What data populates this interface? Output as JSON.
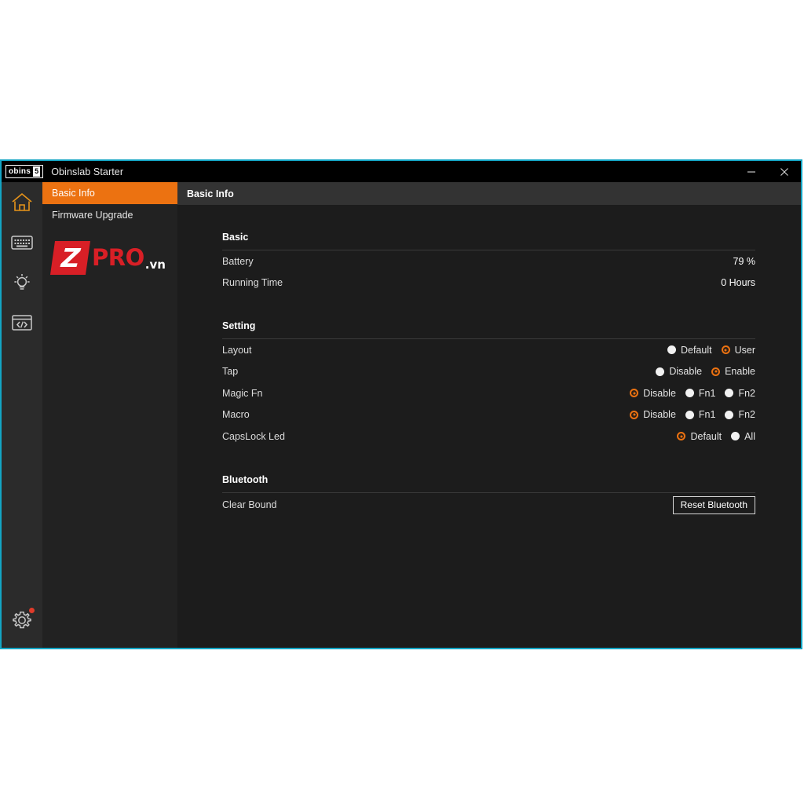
{
  "window": {
    "title": "Obinslab Starter",
    "brand_badge_text": "obins",
    "brand_badge_mark": "5",
    "minimize_label": "Minimize",
    "close_label": "Close",
    "border_color": "#13a5c4"
  },
  "icon_rail": {
    "items": [
      {
        "name": "home-icon",
        "label": "Home",
        "active": true
      },
      {
        "name": "keyboard-icon",
        "label": "Keyboard",
        "active": false
      },
      {
        "name": "lightbulb-icon",
        "label": "Lighting",
        "active": false
      },
      {
        "name": "code-icon",
        "label": "Macro Code",
        "active": false
      }
    ],
    "settings": {
      "name": "gear-icon",
      "label": "Settings",
      "badge": true,
      "badge_color": "#e03b2a"
    }
  },
  "sidebar": {
    "items": [
      {
        "label": "Basic Info",
        "selected": true
      },
      {
        "label": "Firmware Upgrade",
        "selected": false
      }
    ],
    "logo": {
      "z": "Z",
      "pro": "PRO",
      "vn": ".vn",
      "red": "#d81f26"
    }
  },
  "content": {
    "header": "Basic Info",
    "accent": "#ec7211",
    "sections": [
      {
        "title": "Basic",
        "rows": [
          {
            "label": "Battery",
            "value": "79 %"
          },
          {
            "label": "Running Time",
            "value": "0 Hours"
          }
        ]
      },
      {
        "title": "Setting",
        "rows": [
          {
            "label": "Layout",
            "options": [
              {
                "label": "Default",
                "selected": false
              },
              {
                "label": "User",
                "selected": true
              }
            ]
          },
          {
            "label": "Tap",
            "options": [
              {
                "label": "Disable",
                "selected": false
              },
              {
                "label": "Enable",
                "selected": true
              }
            ]
          },
          {
            "label": "Magic Fn",
            "options": [
              {
                "label": "Disable",
                "selected": true
              },
              {
                "label": "Fn1",
                "selected": false
              },
              {
                "label": "Fn2",
                "selected": false
              }
            ]
          },
          {
            "label": "Macro",
            "options": [
              {
                "label": "Disable",
                "selected": true
              },
              {
                "label": "Fn1",
                "selected": false
              },
              {
                "label": "Fn2",
                "selected": false
              }
            ]
          },
          {
            "label": "CapsLock Led",
            "options": [
              {
                "label": "Default",
                "selected": true
              },
              {
                "label": "All",
                "selected": false
              }
            ]
          }
        ]
      },
      {
        "title": "Bluetooth",
        "rows": [
          {
            "label": "Clear Bound",
            "button": "Reset Bluetooth"
          }
        ]
      }
    ]
  }
}
